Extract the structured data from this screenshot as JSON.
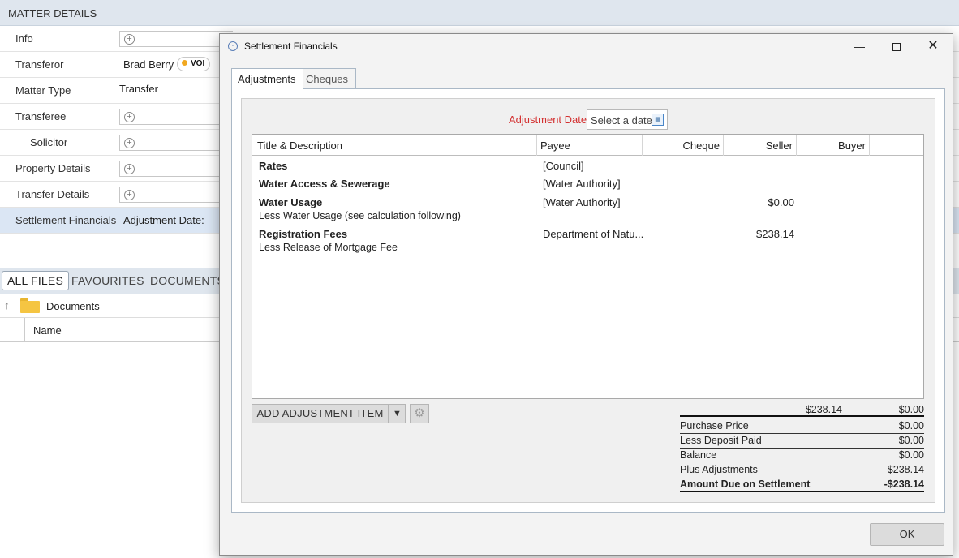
{
  "matter": {
    "header": "MATTER DETAILS",
    "rows": [
      {
        "label": "Info"
      },
      {
        "label": "Transferor",
        "value": "Brad Berry",
        "badge": "VOI"
      },
      {
        "label": "Matter Type",
        "value": "Transfer"
      },
      {
        "label": "Transferee"
      },
      {
        "label": "Solicitor"
      },
      {
        "label": "Property Details"
      },
      {
        "label": "Transfer Details"
      },
      {
        "label": "Settlement Financials",
        "value": "Adjustment Date:"
      }
    ]
  },
  "files": {
    "tabs": [
      "ALL FILES",
      "FAVOURITES",
      "DOCUMENTS"
    ],
    "folder": "Documents",
    "column": "Name"
  },
  "dialog": {
    "title": "Settlement Financials",
    "tabs": [
      "Adjustments",
      "Cheques"
    ],
    "adjustment_date_label": "Adjustment Date:",
    "date_placeholder": "Select a date",
    "columns": [
      "Title & Description",
      "Payee",
      "Cheque",
      "Seller",
      "Buyer"
    ],
    "rows": [
      {
        "title": "Rates",
        "description": "",
        "payee": "[Council]",
        "seller": ""
      },
      {
        "title": "Water Access & Sewerage",
        "description": "",
        "payee": "[Water Authority]",
        "seller": ""
      },
      {
        "title": "Water Usage",
        "description": "Less Water Usage (see calculation following)",
        "payee": "[Water Authority]",
        "seller": "$0.00"
      },
      {
        "title": "Registration Fees",
        "description": "Less Release of Mortgage Fee",
        "payee": "Department of Natu...",
        "seller": "$238.14"
      }
    ],
    "add_button": "ADD ADJUSTMENT ITEM",
    "totals": {
      "seller_total": "$238.14",
      "buyer_total": "$0.00",
      "lines": [
        {
          "label": "Purchase Price",
          "value": "$0.00"
        },
        {
          "label": "Less Deposit Paid",
          "value": "$0.00"
        },
        {
          "label": "Balance",
          "value": "$0.00"
        },
        {
          "label": "Plus Adjustments",
          "value": "-$238.14"
        },
        {
          "label": "Amount Due on Settlement",
          "value": "-$238.14"
        }
      ]
    },
    "ok_label": "OK"
  }
}
